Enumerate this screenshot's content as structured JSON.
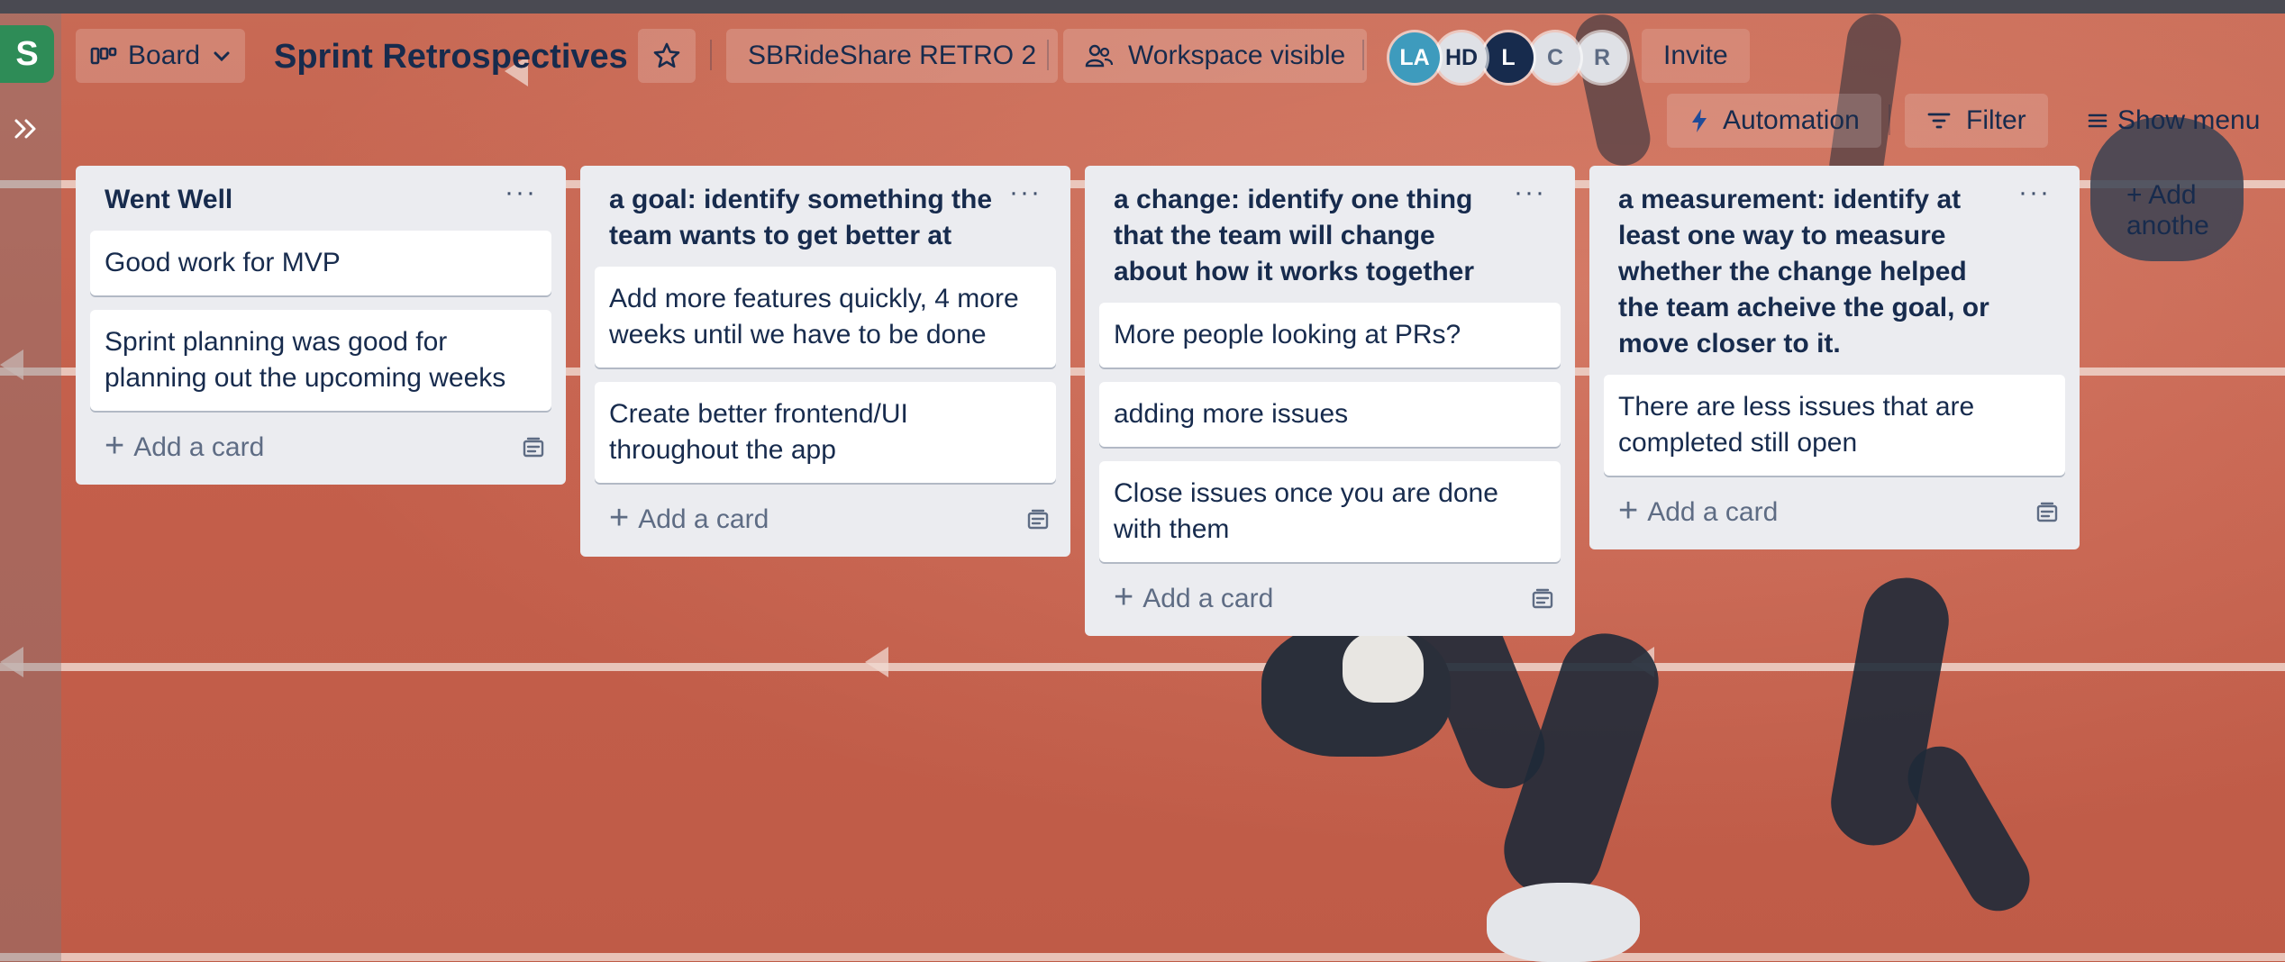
{
  "workspace": {
    "initial": "S"
  },
  "header": {
    "view_label": "Board",
    "title": "Sprint Retrospectives",
    "workspace_name": "SBRideShare RETRO 2",
    "visibility": "Workspace visible",
    "invite": "Invite",
    "automation": "Automation",
    "filter": "Filter",
    "show_menu": "Show menu"
  },
  "members": [
    {
      "initials": "LA",
      "bg": "#3e9bbd",
      "fg": "#ffffff"
    },
    {
      "initials": "HD",
      "bg": "#dfe1e6",
      "fg": "#172b4d"
    },
    {
      "initials": "L",
      "bg": "#172b4d",
      "fg": "#ffffff"
    },
    {
      "initials": "C",
      "bg": "#dfe1e6",
      "fg": "#5e6c84"
    },
    {
      "initials": "R",
      "bg": "#dfe1e6",
      "fg": "#5e6c84"
    }
  ],
  "lists": [
    {
      "title": "Went Well",
      "cards": [
        "Good work for MVP",
        "Sprint planning was good for planning out the upcoming weeks"
      ],
      "add_card": "Add a card"
    },
    {
      "title": "a goal: identify something the team wants to get better at",
      "cards": [
        "Add more features quickly, 4 more weeks until we have to be done",
        "Create better frontend/UI throughout the app"
      ],
      "add_card": "Add a card"
    },
    {
      "title": "a change: identify one thing that the team will change about how it works together",
      "cards": [
        "More people looking at PRs?",
        "adding more issues",
        "Close issues once you are done with them"
      ],
      "add_card": "Add a card"
    },
    {
      "title": "a measurement: identify at least one way to measure whether the change helped the team acheive the goal, or move closer to it.",
      "cards": [
        "There are less issues that are completed still open"
      ],
      "add_card": "Add a card"
    }
  ],
  "add_another_list": "+ Add anothe"
}
